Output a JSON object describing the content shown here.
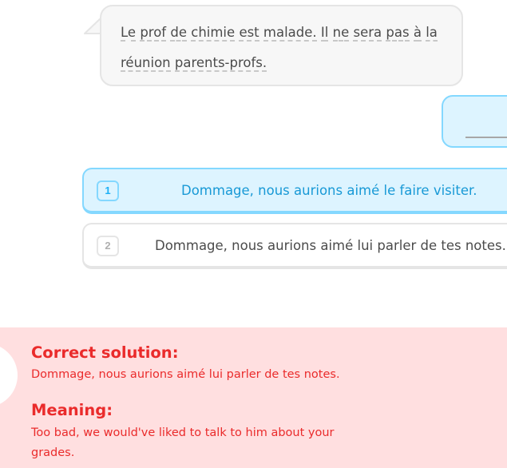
{
  "prompt": {
    "words": [
      "Le",
      "prof",
      "de",
      "chimie",
      "est",
      "malade.",
      "Il",
      "ne",
      "sera",
      "pas",
      "à",
      "la",
      "réunion",
      "parents-profs."
    ]
  },
  "choices": [
    {
      "number": "1",
      "label": "Dommage, nous aurions aimé le faire visiter.",
      "selected": true
    },
    {
      "number": "2",
      "label": "Dommage, nous aurions aimé lui parler de tes notes.",
      "selected": false
    }
  ],
  "feedback": {
    "correct_heading": "Correct solution:",
    "correct_text": "Dommage, nous aurions aimé lui parler de tes notes.",
    "meaning_heading": "Meaning:",
    "meaning_text": "Too bad, we would've liked to talk to him about your grades."
  },
  "colors": {
    "selected_bg": "#ddf4ff",
    "selected_border": "#84d8ff",
    "error_bg": "#ffdfe0",
    "error_text": "#ea2b2b"
  }
}
